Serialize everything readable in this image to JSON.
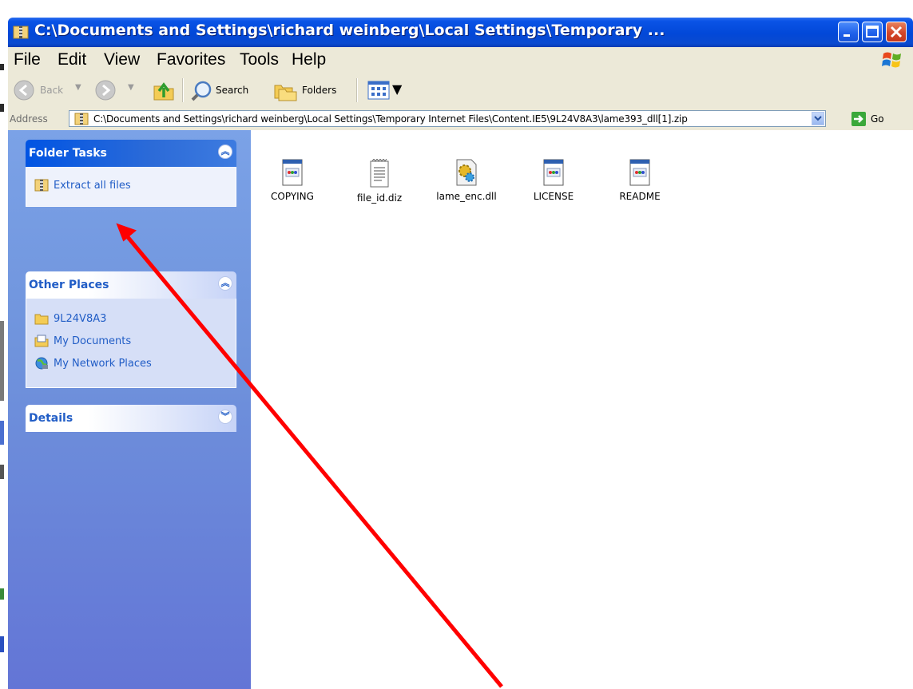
{
  "top_strip_text": "",
  "window": {
    "title": "C:\\Documents and Settings\\richard weinberg\\Local Settings\\Temporary ...",
    "caption_buttons": [
      "minimize",
      "maximize",
      "close"
    ]
  },
  "menu": {
    "items": [
      "File",
      "Edit",
      "View",
      "Favorites",
      "Tools",
      "Help"
    ]
  },
  "toolbar": {
    "back_label": "Back",
    "search_label": "Search",
    "folders_label": "Folders"
  },
  "address": {
    "label": "Address",
    "value": "C:\\Documents and Settings\\richard weinberg\\Local Settings\\Temporary Internet Files\\Content.IE5\\9L24V8A3\\lame393_dll[1].zip",
    "go_label": "Go"
  },
  "task_pane": {
    "folder_tasks": {
      "title": "Folder Tasks",
      "items": [
        "Extract all files"
      ]
    },
    "other_places": {
      "title": "Other Places",
      "items": [
        "9L24V8A3",
        "My Documents",
        "My Network Places"
      ]
    },
    "details": {
      "title": "Details"
    }
  },
  "files": [
    "COPYING",
    "file_id.diz",
    "lame_enc.dll",
    "LICENSE",
    "README"
  ],
  "colors": {
    "titlebar": "#0248d8",
    "menubar": "#ece9d8",
    "taskpane": "#6f93dc",
    "task_link": "#215dc6",
    "annotation_arrow": "#ff0000"
  }
}
